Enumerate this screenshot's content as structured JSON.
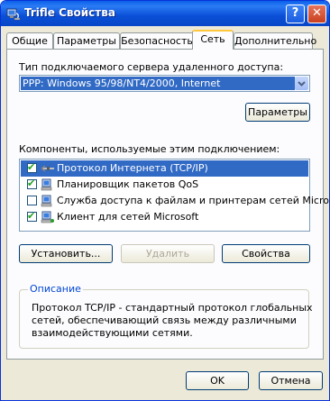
{
  "window": {
    "title": "Trifle Свойства",
    "help_label": "?",
    "close_label": "✕"
  },
  "tabs": [
    {
      "label": "Общие"
    },
    {
      "label": "Параметры"
    },
    {
      "label": "Безопасность"
    },
    {
      "label": "Сеть"
    },
    {
      "label": "Дополнительно"
    }
  ],
  "active_tab": "Сеть",
  "server": {
    "label": "Тип подключаемого сервера удаленного доступа:",
    "value": "PPP: Windows 95/98/NT4/2000, Internet",
    "settings_button": "Параметры"
  },
  "components": {
    "label": "Компоненты, используемые этим подключением:",
    "items": [
      {
        "label": "Протокол Интернета (TCP/IP)",
        "checked": true,
        "icon": "protocol-icon",
        "selected": true
      },
      {
        "label": "Планировщик пакетов QoS",
        "checked": true,
        "icon": "network-service-icon",
        "selected": false
      },
      {
        "label": "Служба доступа к файлам и принтерам сетей Microsoft",
        "checked": false,
        "icon": "network-service-icon",
        "selected": false
      },
      {
        "label": "Клиент для сетей Microsoft",
        "checked": true,
        "icon": "network-client-icon",
        "selected": false
      }
    ]
  },
  "actions": {
    "install": "Установить...",
    "remove": "Удалить",
    "properties": "Свойства"
  },
  "description": {
    "title": "Описание",
    "lines": [
      "Протокол TCP/IP - стандартный протокол глобальных",
      "сетей, обеспечивающий связь между различными",
      "взаимодействующими сетями."
    ]
  },
  "footer": {
    "ok": "OK",
    "cancel": "Отмена"
  },
  "colors": {
    "titlebar": "#0a4fd7",
    "selection": "#316ac5",
    "dialog_bg": "#ece9d8",
    "group_title": "#0046d5",
    "active_tab_accent": "#ffc83c"
  }
}
